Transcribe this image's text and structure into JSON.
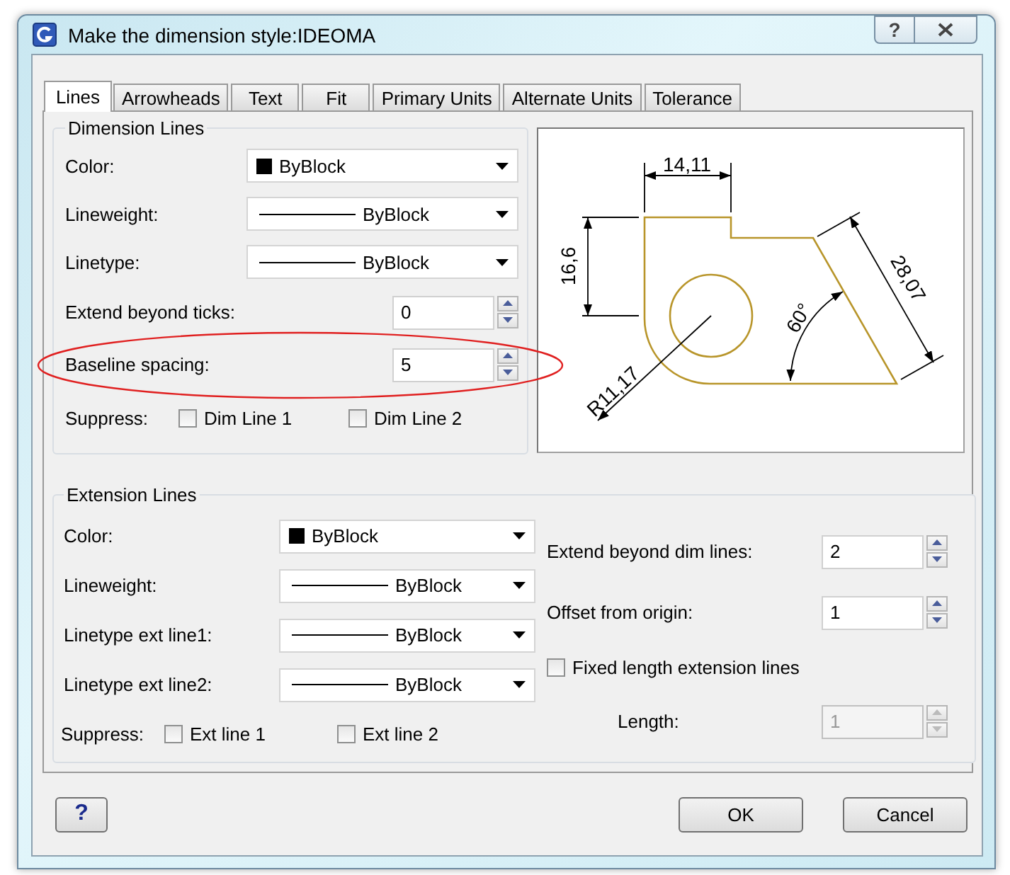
{
  "window": {
    "title": "Make the dimension style:IDEOMA",
    "help_glyph": "?"
  },
  "tabs": [
    {
      "label": "Lines",
      "selected": true
    },
    {
      "label": "Arrowheads",
      "selected": false
    },
    {
      "label": "Text",
      "selected": false
    },
    {
      "label": "Fit",
      "selected": false
    },
    {
      "label": "Primary Units",
      "selected": false
    },
    {
      "label": "Alternate Units",
      "selected": false
    },
    {
      "label": "Tolerance",
      "selected": false
    }
  ],
  "dimension_lines": {
    "title": "Dimension Lines",
    "rows": [
      {
        "kind": "color",
        "label": "Color:",
        "value": "ByBlock",
        "highlighted": false
      },
      {
        "kind": "line",
        "label": "Lineweight:",
        "value": "ByBlock",
        "highlighted": false
      },
      {
        "kind": "line",
        "label": "Linetype:",
        "value": "ByBlock",
        "highlighted": false
      },
      {
        "kind": "spinner",
        "label": "Extend beyond ticks:",
        "value": "0",
        "disabled": false,
        "highlighted": false
      },
      {
        "kind": "spinner",
        "label": "Baseline spacing:",
        "value": "5",
        "disabled": false,
        "highlighted": true
      }
    ],
    "suppress": {
      "label": "Suppress:",
      "checkboxes": [
        {
          "label": "Dim Line 1",
          "checked": false
        },
        {
          "label": "Dim Line 2",
          "checked": false
        }
      ]
    }
  },
  "preview": {
    "labels": [
      "14,11",
      "16,6",
      "28,07",
      "60°",
      "R11,17"
    ]
  },
  "extension_lines": {
    "title": "Extension Lines",
    "left_rows": [
      {
        "kind": "color",
        "label": "Color:",
        "value": "ByBlock"
      },
      {
        "kind": "line",
        "label": "Lineweight:",
        "value": "ByBlock"
      },
      {
        "kind": "line",
        "label": "Linetype ext line1:",
        "value": "ByBlock"
      },
      {
        "kind": "line",
        "label": "Linetype ext line2:",
        "value": "ByBlock"
      }
    ],
    "suppress": {
      "label": "Suppress:",
      "checkboxes": [
        {
          "label": "Ext line 1",
          "checked": false
        },
        {
          "label": "Ext line 2",
          "checked": false
        }
      ]
    },
    "right_rows": [
      {
        "kind": "spinner",
        "label": "Extend beyond dim lines:",
        "value": "2",
        "disabled": false
      },
      {
        "kind": "spinner",
        "label": "Offset from origin:",
        "value": "1",
        "disabled": false
      },
      {
        "kind": "checkbox",
        "label": "Fixed length extension lines",
        "checked": false
      },
      {
        "kind": "spinner",
        "label": "Length:",
        "value": "1",
        "disabled": true
      }
    ]
  },
  "buttons": {
    "help": "?",
    "ok": "OK",
    "cancel": "Cancel"
  }
}
